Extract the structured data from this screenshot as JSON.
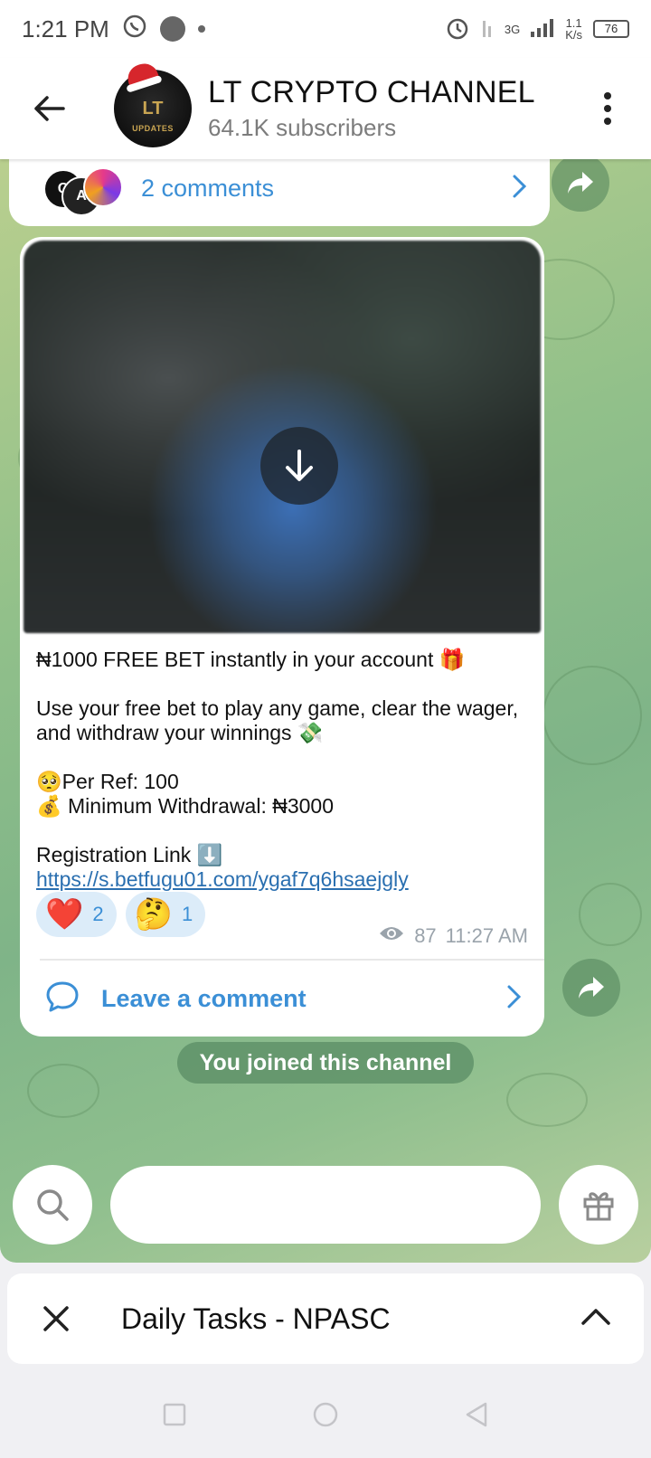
{
  "status_bar": {
    "time": "1:21 PM",
    "network": "3G",
    "speed": "1.1",
    "speed_unit": "K/s",
    "battery": "76"
  },
  "header": {
    "title": "LT CRYPTO CHANNEL",
    "subscribers": "64.1K subscribers",
    "avatar_text": "LT",
    "avatar_sub": "UPDATES"
  },
  "prev_post": {
    "comments_label": "2 comments",
    "commenter_initials": [
      "Q",
      "A"
    ]
  },
  "post": {
    "line1": "₦1000 FREE BET instantly in your account 🎁",
    "line2": "Use your free bet to play any game, clear the wager, and withdraw your winnings 💸",
    "per_ref": "🥺Per Ref: 100",
    "min_withdrawal": "💰 Minimum Withdrawal: ₦3000",
    "registration": "Registration Link ⬇️",
    "link": "https://s.betfugu01.com/ygaf7q6hsaejgly",
    "reactions": [
      {
        "emoji": "❤️",
        "count": "2"
      },
      {
        "emoji": "🤔",
        "count": "1"
      }
    ],
    "views": "87",
    "time": "11:27 AM",
    "leave_comment": "Leave a comment"
  },
  "service_message": "You joined this channel",
  "banner": {
    "title": "Daily Tasks - NPASC"
  },
  "colors": {
    "accent": "#3b8fd6",
    "link": "#2a6fb0",
    "reaction_bg": "#dcecf9"
  }
}
